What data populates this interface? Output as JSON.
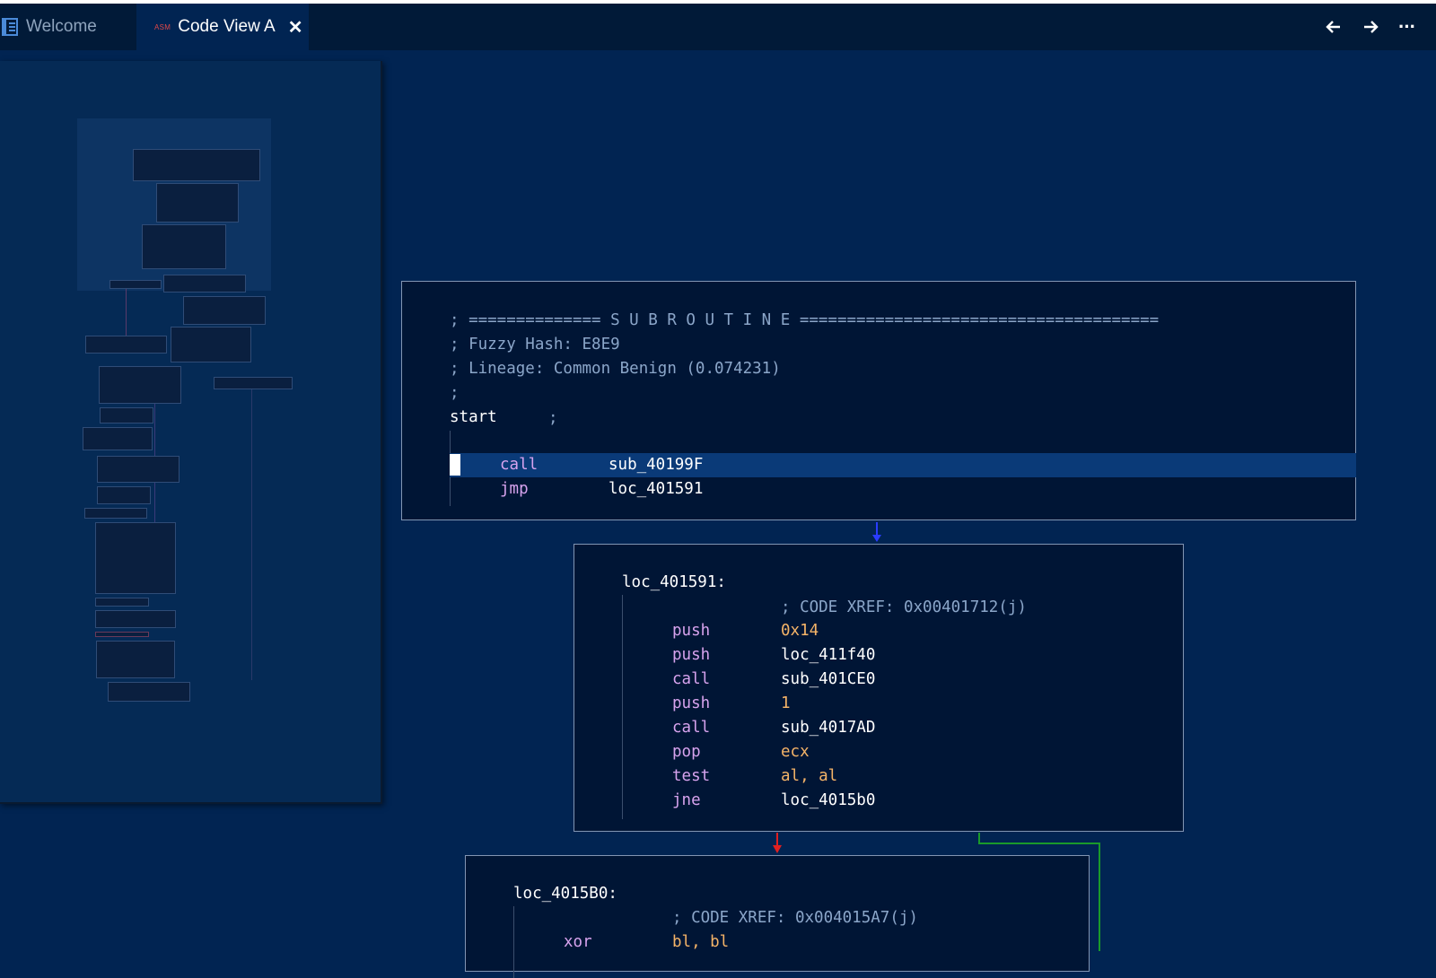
{
  "tabs": {
    "welcome": "Welcome",
    "active_badge": "ASM",
    "active": "Code View A",
    "close": "✕"
  },
  "nav": {
    "back": "🡐",
    "forward": "🡒",
    "more": "···"
  },
  "block1": {
    "l1": "; ============== S U B R O U T I N E ======================================",
    "l2": "; Fuzzy Hash: E8E9",
    "l3": "; Lineage: Common Benign (0.074231)",
    "l4": ";",
    "label": "start",
    "label_comment": ";",
    "i1_m": "call",
    "i1_o": "sub_40199F",
    "i2_m": "jmp",
    "i2_o": "loc_401591"
  },
  "block2": {
    "label": "loc_401591:",
    "xref": "; CODE XREF: 0x00401712(j)",
    "rows": [
      {
        "m": "push",
        "o": "0x14"
      },
      {
        "m": "push",
        "o": "loc_411f40"
      },
      {
        "m": "call",
        "o": "sub_401CE0"
      },
      {
        "m": "push",
        "o": "1"
      },
      {
        "m": "call",
        "o": "sub_4017AD"
      },
      {
        "m": "pop",
        "o": "ecx"
      },
      {
        "m": "test",
        "o": "al, al"
      },
      {
        "m": "jne",
        "o": "loc_4015b0"
      }
    ]
  },
  "block3": {
    "label": "loc_4015B0:",
    "xref": "; CODE XREF: 0x004015A7(j)",
    "i1_m": "xor",
    "i1_o": "bl, bl"
  },
  "colors": {
    "background": "#012452",
    "tabbar": "#011a38",
    "mnemonic": "#d7a3ee",
    "immediate": "#f5b468",
    "comment": "#8ba6c9",
    "edge_true": "#1a9a2a",
    "edge_false": "#e02020",
    "edge_uncond": "#2a3cff"
  }
}
